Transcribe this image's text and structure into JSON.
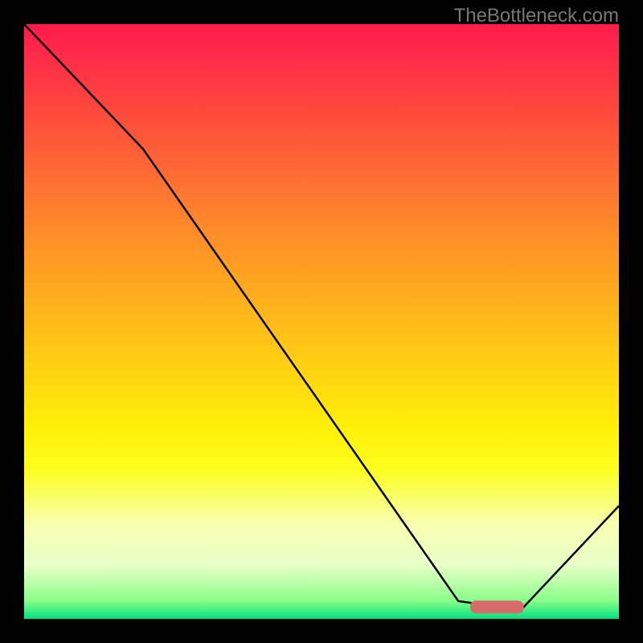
{
  "watermark": "TheBottleneck.com",
  "chart_data": {
    "type": "line",
    "title": "",
    "xlabel": "",
    "ylabel": "",
    "xlim": [
      0,
      100
    ],
    "ylim": [
      0,
      100
    ],
    "series": [
      {
        "name": "bottleneck-curve",
        "points": [
          {
            "x": 0,
            "y": 100
          },
          {
            "x": 20,
            "y": 79
          },
          {
            "x": 73,
            "y": 3
          },
          {
            "x": 80,
            "y": 2
          },
          {
            "x": 84,
            "y": 2
          },
          {
            "x": 100,
            "y": 19
          }
        ],
        "color": "#000000"
      },
      {
        "name": "optimal-marker",
        "type": "marker",
        "points": [
          {
            "x": 75,
            "y": 2
          },
          {
            "x": 84,
            "y": 2
          }
        ],
        "color": "#d86a6a"
      }
    ],
    "background_gradient": {
      "type": "vertical",
      "stops": [
        {
          "pos": 0,
          "color": "#ff1a4a"
        },
        {
          "pos": 50,
          "color": "#ffc018"
        },
        {
          "pos": 75,
          "color": "#fdff20"
        },
        {
          "pos": 100,
          "color": "#00e080"
        }
      ]
    }
  }
}
